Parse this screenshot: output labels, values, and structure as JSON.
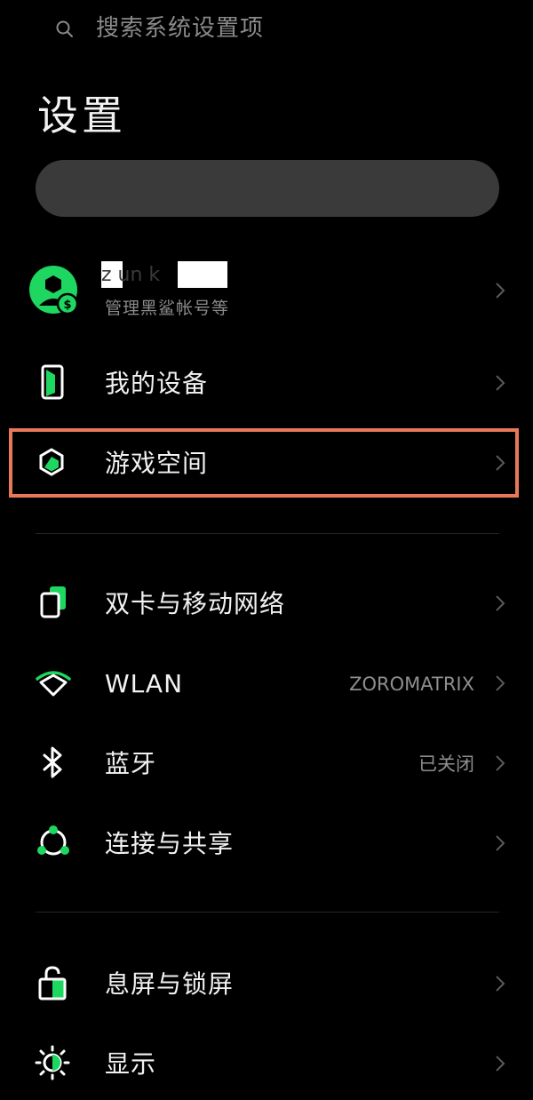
{
  "header": {
    "title": "设置"
  },
  "search": {
    "placeholder": "搜索系统设置项"
  },
  "account": {
    "name_partial": "z  un  k",
    "subtitle": "管理黑鲨帐号等"
  },
  "sections": [
    {
      "items": [
        {
          "label": "我的设备",
          "icon": "device-icon"
        },
        {
          "label": "游戏空间",
          "icon": "game-space-icon",
          "highlighted": true
        }
      ]
    },
    {
      "items": [
        {
          "label": "双卡与移动网络",
          "icon": "sim-card-icon"
        },
        {
          "label": "WLAN",
          "icon": "wifi-icon",
          "value": "ZOROMATRIX"
        },
        {
          "label": "蓝牙",
          "icon": "bluetooth-icon",
          "value": "已关闭"
        },
        {
          "label": "连接与共享",
          "icon": "share-connection-icon"
        }
      ]
    },
    {
      "items": [
        {
          "label": "息屏与锁屏",
          "icon": "lock-icon"
        },
        {
          "label": "显示",
          "icon": "brightness-icon"
        }
      ]
    }
  ],
  "colors": {
    "background": "#000000",
    "accent_green": "#1ed760",
    "highlight_border": "#e8785a",
    "search_bg": "#3a3a3a"
  }
}
